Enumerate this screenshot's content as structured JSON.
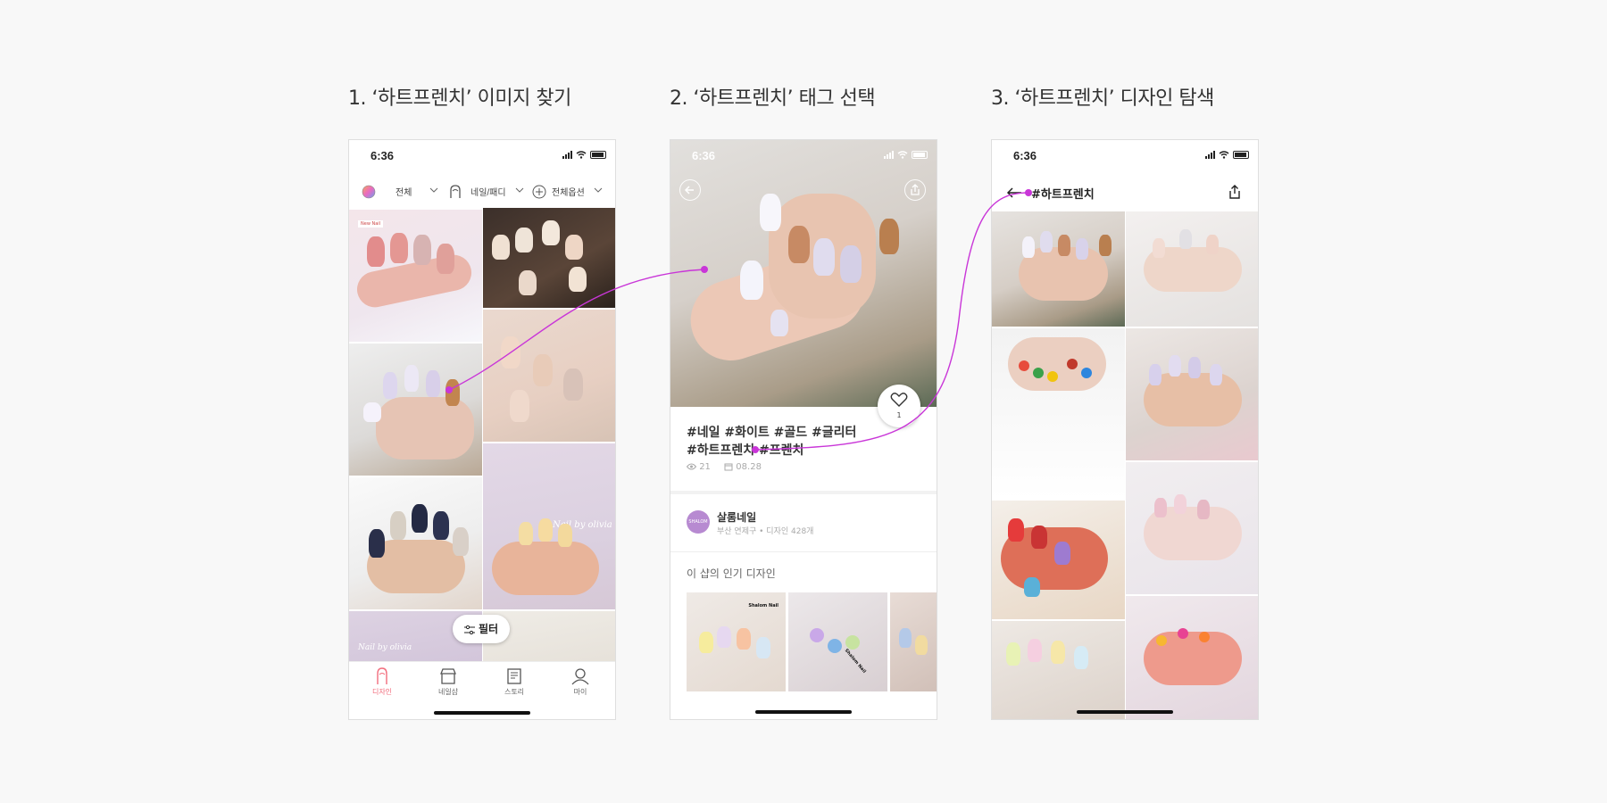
{
  "steps": [
    {
      "title": "1. ‘하트프렌치’ 이미지 찾기"
    },
    {
      "title": "2. ‘하트프렌치’ 태그 선택"
    },
    {
      "title": "3. ‘하트프렌치’ 디자인 탐색"
    }
  ],
  "status_time": "6:36",
  "phone1": {
    "filters": {
      "color_label": "전체",
      "category_label": "네일/패디",
      "options_label": "전체옵션"
    },
    "tile_badge": "New Nail",
    "watermark": "Nail by olivia",
    "filter_button": "필터",
    "tabs": [
      {
        "label": "디자인",
        "icon": "nail-icon",
        "active": true
      },
      {
        "label": "네일샵",
        "icon": "shop-icon",
        "active": false
      },
      {
        "label": "스토리",
        "icon": "book-icon",
        "active": false
      },
      {
        "label": "마이",
        "icon": "user-icon",
        "active": false
      }
    ]
  },
  "phone2": {
    "tags_line1": "#네일 #화이트 #골드 #글리터",
    "tags_line2": "#하트프렌치 #프렌치",
    "views": "21",
    "date": "08.28",
    "like_count": "1",
    "shop": {
      "name": "살롬네일",
      "location": "부산 연제구 • 디자인 428개",
      "avatar_text": "SHALOM NAIL"
    },
    "popular_title": "이 샵의 인기 디자인",
    "thumb_labels": [
      "Shalom Nail",
      "Shalom Nail"
    ]
  },
  "phone3": {
    "title": "#하트프렌치"
  },
  "colors": {
    "accent": "#c936d8",
    "active_tab": "#f26d7d",
    "background": "#f8f8f8"
  }
}
